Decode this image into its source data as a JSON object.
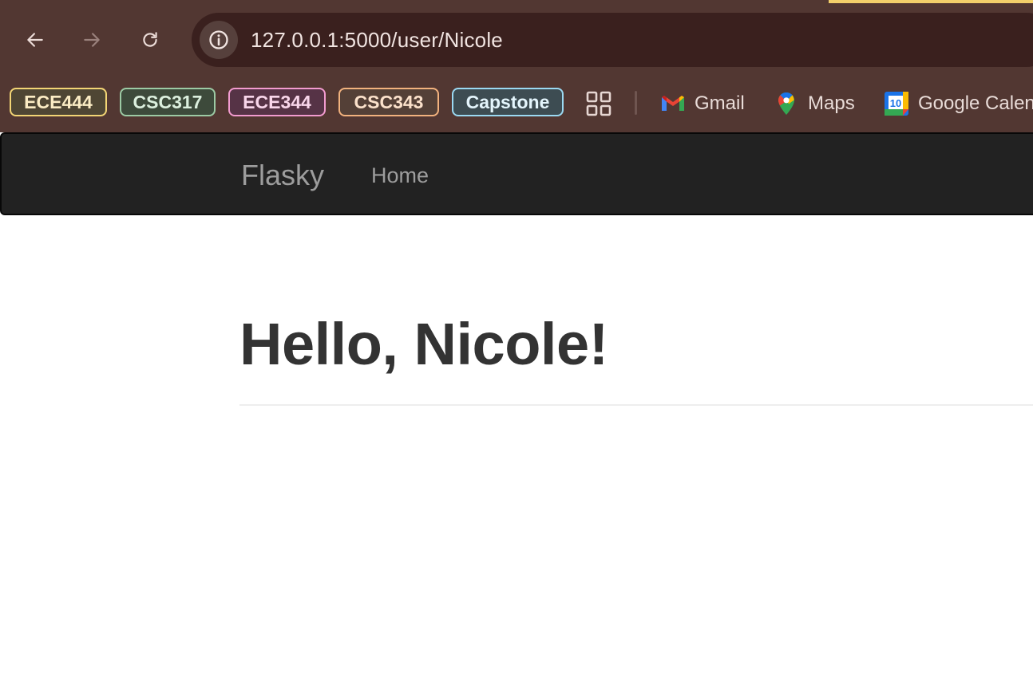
{
  "browser": {
    "nav": {
      "back_icon": "arrow-left-icon",
      "forward_icon": "arrow-right-icon",
      "reload_icon": "reload-icon"
    },
    "address_bar": {
      "url": "127.0.0.1:5000/user/Nicole",
      "site_info_icon": "info-icon"
    },
    "tab_accent_color": "#f3cf6a",
    "bookmarks": {
      "chips": [
        {
          "label": "ECE444",
          "border": "#f3d575",
          "background": "#4f4634",
          "text": "#fbecc4"
        },
        {
          "label": "CSC317",
          "border": "#9ccaa4",
          "background": "#3d4a3b",
          "text": "#dcefde"
        },
        {
          "label": "ECE344",
          "border": "#f29bcf",
          "background": "#563346",
          "text": "#f8d6ea"
        },
        {
          "label": "CSC343",
          "border": "#f2b27e",
          "background": "#544037",
          "text": "#fbe1cb"
        },
        {
          "label": "Capstone",
          "border": "#9bd9f2",
          "background": "#3d4c52",
          "text": "#e4f5fc"
        }
      ],
      "apps_icon": "apps-grid-icon",
      "links": [
        {
          "label": "Gmail",
          "icon": "gmail-icon"
        },
        {
          "label": "Maps",
          "icon": "maps-icon"
        },
        {
          "label": "Google Calen",
          "icon": "google-calendar-icon",
          "icon_text": "10"
        }
      ]
    }
  },
  "page": {
    "navbar": {
      "brand": "Flasky",
      "links": [
        "Home"
      ]
    },
    "heading": "Hello, Nicole!"
  }
}
